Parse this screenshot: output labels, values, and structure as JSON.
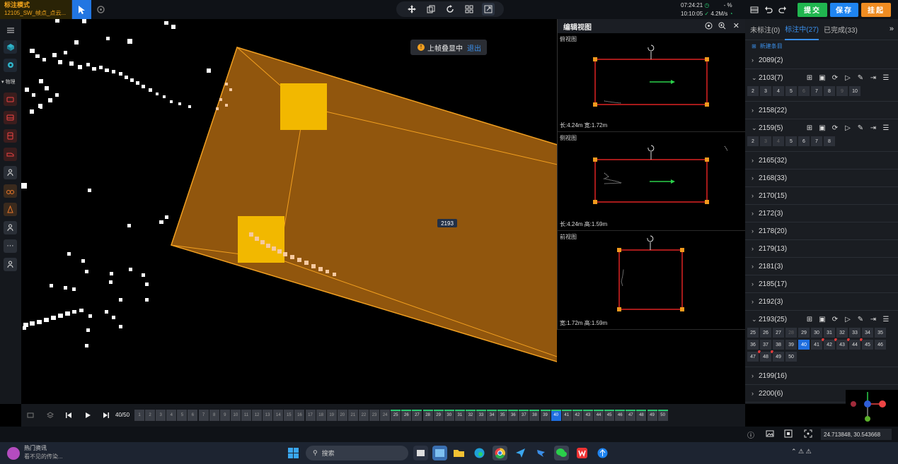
{
  "header": {
    "mode_title": "标注模式",
    "task_name": "12105_SW_帧点_点云...",
    "time": "07:24:21",
    "status_dash": "- %",
    "time2": "10:10:05",
    "speed": "4.2M/s",
    "submit_label": "提交",
    "save_label": "保存",
    "suspend_label": "挂起"
  },
  "left_toolbar": {
    "section_label": "物理"
  },
  "canvas": {
    "overlay_status": "上帧叠显中",
    "overlay_exit": "退出",
    "object_label": "2193"
  },
  "edit_view": {
    "title": "编辑视图",
    "panels": [
      {
        "title": "俯视图",
        "dims": "长:4.24m 宽:1.72m"
      },
      {
        "title": "侧视图",
        "dims": "长:4.24m 高:1.59m"
      },
      {
        "title": "前视图",
        "dims": "宽:1.72m 高:1.59m"
      }
    ]
  },
  "right_panel": {
    "tabs": [
      "未标注(0)",
      "标注中(27)",
      "已完成(33)"
    ],
    "active_tab": 1,
    "new_entry": "新建条目",
    "groups": [
      {
        "label": "2089(2)",
        "expanded": false
      },
      {
        "label": "2103(7)",
        "expanded": true,
        "frames": [
          [
            "2",
            ""
          ],
          [
            "3",
            ""
          ],
          [
            "4",
            ""
          ],
          [
            "5",
            ""
          ],
          [
            "6",
            "dim"
          ],
          [
            "7",
            ""
          ],
          [
            "8",
            ""
          ],
          [
            "9",
            "dim"
          ],
          [
            "10",
            ""
          ]
        ]
      },
      {
        "label": "2158(22)",
        "expanded": false
      },
      {
        "label": "2159(5)",
        "expanded": true,
        "frames": [
          [
            "2",
            ""
          ],
          [
            "3",
            "dim"
          ],
          [
            "4",
            "dim"
          ],
          [
            "5",
            ""
          ],
          [
            "6",
            ""
          ],
          [
            "7",
            ""
          ],
          [
            "8",
            ""
          ]
        ]
      },
      {
        "label": "2165(32)",
        "expanded": false
      },
      {
        "label": "2168(33)",
        "expanded": false
      },
      {
        "label": "2170(15)",
        "expanded": false
      },
      {
        "label": "2172(3)",
        "expanded": false
      },
      {
        "label": "2178(20)",
        "expanded": false
      },
      {
        "label": "2179(13)",
        "expanded": false
      },
      {
        "label": "2181(3)",
        "expanded": false
      },
      {
        "label": "2185(17)",
        "expanded": false
      },
      {
        "label": "2192(3)",
        "expanded": false
      },
      {
        "label": "2193(25)",
        "expanded": true,
        "frames": [
          [
            "25",
            ""
          ],
          [
            "26",
            ""
          ],
          [
            "27",
            ""
          ],
          [
            "28",
            "dim"
          ],
          [
            "29",
            ""
          ],
          [
            "30",
            ""
          ],
          [
            "31",
            ""
          ],
          [
            "32",
            ""
          ],
          [
            "33",
            ""
          ],
          [
            "34",
            ""
          ],
          [
            "35",
            ""
          ],
          [
            "36",
            ""
          ],
          [
            "37",
            ""
          ],
          [
            "38",
            ""
          ],
          [
            "39",
            ""
          ],
          [
            "40",
            "cur"
          ],
          [
            "41",
            "kf"
          ],
          [
            "42",
            "kf"
          ],
          [
            "43",
            "kf"
          ],
          [
            "44",
            "kf"
          ],
          [
            "45",
            ""
          ],
          [
            "46",
            ""
          ],
          [
            "47",
            "kf"
          ],
          [
            "48",
            "kf"
          ],
          [
            "49",
            ""
          ],
          [
            "50",
            ""
          ]
        ]
      },
      {
        "label": "2199(16)",
        "expanded": false
      },
      {
        "label": "2200(6)",
        "expanded": false
      }
    ]
  },
  "timeline": {
    "frame_counter": "40/50",
    "current_frame": 40,
    "total_frames": 50,
    "annotated_from": 25
  },
  "status": {
    "coordinates": "24.713848, 30.543668"
  },
  "taskbar": {
    "news_title": "热门资讯",
    "news_sub": "看不见的传染...",
    "search_placeholder": "搜索"
  }
}
